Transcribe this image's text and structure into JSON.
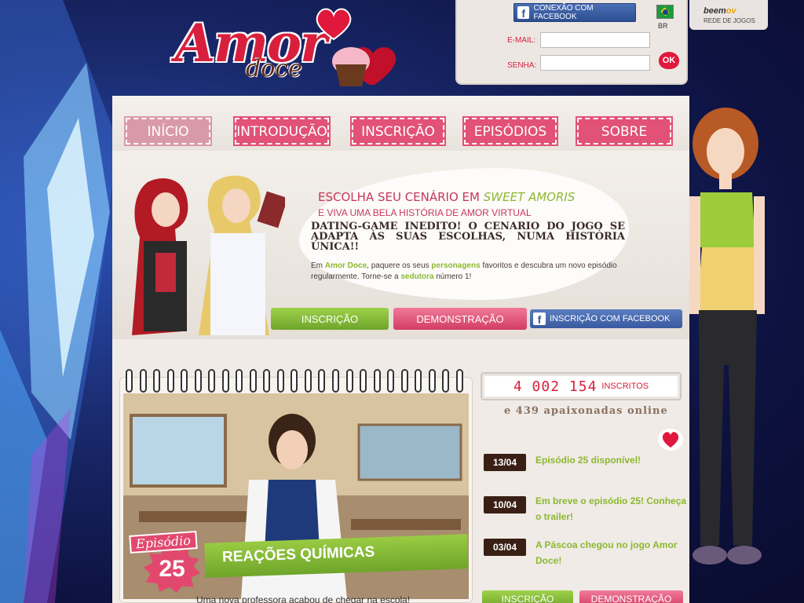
{
  "logo": {
    "amor": "Amor",
    "doce": "doce"
  },
  "login": {
    "fb_connect": "CONEXÃO COM FACEBOOK",
    "lang": "BR",
    "email_label": "E-MAIL:",
    "password_label": "SENHA:",
    "ok_label": "OK"
  },
  "network": {
    "name_prefix": "beem",
    "name_suffix": "ov",
    "label": "REDE DE JOGOS"
  },
  "nav": {
    "items": [
      "INÍCIO",
      "INTRODUÇÃO",
      "INSCRIÇÃO",
      "EPISÓDIOS",
      "SOBRE"
    ]
  },
  "hero": {
    "line1_prefix": "ESCOLHA SEU CENÁRIO EM ",
    "line1_em": "SWEET AMORIS",
    "line2": "E VIVA UMA BELA HISTÓRIA DE AMOR VIRTUAL",
    "headline": "DATING-GAME INEDITO! O CENARIO DO JOGO SE ADAPTA ÀS SUAS ESCOLHAS, NUMA HISTÓRIA ÚNICA!!",
    "p_1": "Em ",
    "p_game": "Amor Doce",
    "p_2": ", paquere os seus ",
    "p_chars": "personagens",
    "p_3": " favoritos e descubra um novo episódio regularmente. Torne-se a ",
    "p_seductress": "sedutora",
    "p_4": " número 1!",
    "btn_signup": "INSCRIÇÃO",
    "btn_demo": "DEMONSTRAÇÃO",
    "btn_fb": "INSCRIÇÃO COM FACEBOOK"
  },
  "episode": {
    "word": "Episódio",
    "number": "25",
    "title": "REAÇÕES QUÍMICAS",
    "desc": "Uma nova professora acabou de chegar na escola!"
  },
  "stats": {
    "count": "4 002 154",
    "count_label": "INSCRITOS",
    "online": "e 439 apaixonadas online"
  },
  "news": [
    {
      "date": "13/04",
      "text": "Episódio 25 disponível!"
    },
    {
      "date": "10/04",
      "text": "Em breve o episódio 25! Conheça o trailer!"
    },
    {
      "date": "03/04",
      "text": "A Páscoa chegou no jogo Amor Doce!"
    }
  ],
  "bottom_buttons": {
    "signup": "INSCRIÇÃO",
    "demo": "DEMONSTRAÇÃO"
  },
  "colors": {
    "brand_red": "#d8203e",
    "pink": "#e25176",
    "green": "#8cb830",
    "facebook": "#3b5998"
  }
}
